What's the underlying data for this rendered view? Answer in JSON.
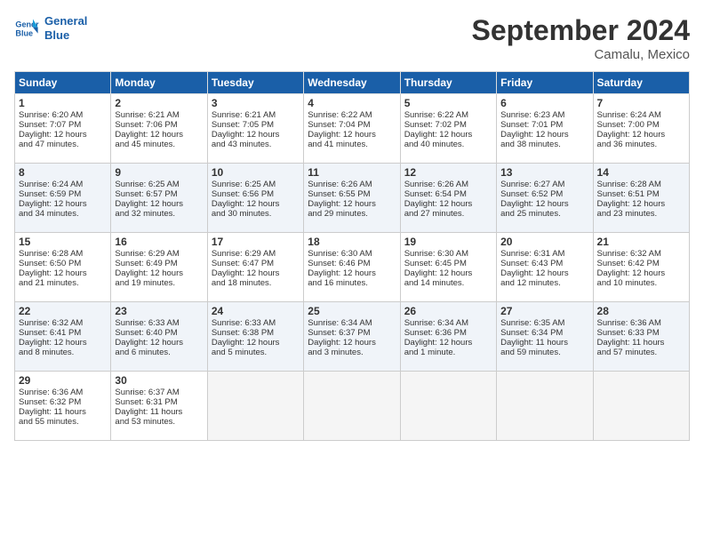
{
  "header": {
    "logo_line1": "General",
    "logo_line2": "Blue",
    "month": "September 2024",
    "location": "Camalu, Mexico"
  },
  "days_of_week": [
    "Sunday",
    "Monday",
    "Tuesday",
    "Wednesday",
    "Thursday",
    "Friday",
    "Saturday"
  ],
  "weeks": [
    [
      {
        "day": "1",
        "lines": [
          "Sunrise: 6:20 AM",
          "Sunset: 7:07 PM",
          "Daylight: 12 hours",
          "and 47 minutes."
        ]
      },
      {
        "day": "2",
        "lines": [
          "Sunrise: 6:21 AM",
          "Sunset: 7:06 PM",
          "Daylight: 12 hours",
          "and 45 minutes."
        ]
      },
      {
        "day": "3",
        "lines": [
          "Sunrise: 6:21 AM",
          "Sunset: 7:05 PM",
          "Daylight: 12 hours",
          "and 43 minutes."
        ]
      },
      {
        "day": "4",
        "lines": [
          "Sunrise: 6:22 AM",
          "Sunset: 7:04 PM",
          "Daylight: 12 hours",
          "and 41 minutes."
        ]
      },
      {
        "day": "5",
        "lines": [
          "Sunrise: 6:22 AM",
          "Sunset: 7:02 PM",
          "Daylight: 12 hours",
          "and 40 minutes."
        ]
      },
      {
        "day": "6",
        "lines": [
          "Sunrise: 6:23 AM",
          "Sunset: 7:01 PM",
          "Daylight: 12 hours",
          "and 38 minutes."
        ]
      },
      {
        "day": "7",
        "lines": [
          "Sunrise: 6:24 AM",
          "Sunset: 7:00 PM",
          "Daylight: 12 hours",
          "and 36 minutes."
        ]
      }
    ],
    [
      {
        "day": "8",
        "lines": [
          "Sunrise: 6:24 AM",
          "Sunset: 6:59 PM",
          "Daylight: 12 hours",
          "and 34 minutes."
        ]
      },
      {
        "day": "9",
        "lines": [
          "Sunrise: 6:25 AM",
          "Sunset: 6:57 PM",
          "Daylight: 12 hours",
          "and 32 minutes."
        ]
      },
      {
        "day": "10",
        "lines": [
          "Sunrise: 6:25 AM",
          "Sunset: 6:56 PM",
          "Daylight: 12 hours",
          "and 30 minutes."
        ]
      },
      {
        "day": "11",
        "lines": [
          "Sunrise: 6:26 AM",
          "Sunset: 6:55 PM",
          "Daylight: 12 hours",
          "and 29 minutes."
        ]
      },
      {
        "day": "12",
        "lines": [
          "Sunrise: 6:26 AM",
          "Sunset: 6:54 PM",
          "Daylight: 12 hours",
          "and 27 minutes."
        ]
      },
      {
        "day": "13",
        "lines": [
          "Sunrise: 6:27 AM",
          "Sunset: 6:52 PM",
          "Daylight: 12 hours",
          "and 25 minutes."
        ]
      },
      {
        "day": "14",
        "lines": [
          "Sunrise: 6:28 AM",
          "Sunset: 6:51 PM",
          "Daylight: 12 hours",
          "and 23 minutes."
        ]
      }
    ],
    [
      {
        "day": "15",
        "lines": [
          "Sunrise: 6:28 AM",
          "Sunset: 6:50 PM",
          "Daylight: 12 hours",
          "and 21 minutes."
        ]
      },
      {
        "day": "16",
        "lines": [
          "Sunrise: 6:29 AM",
          "Sunset: 6:49 PM",
          "Daylight: 12 hours",
          "and 19 minutes."
        ]
      },
      {
        "day": "17",
        "lines": [
          "Sunrise: 6:29 AM",
          "Sunset: 6:47 PM",
          "Daylight: 12 hours",
          "and 18 minutes."
        ]
      },
      {
        "day": "18",
        "lines": [
          "Sunrise: 6:30 AM",
          "Sunset: 6:46 PM",
          "Daylight: 12 hours",
          "and 16 minutes."
        ]
      },
      {
        "day": "19",
        "lines": [
          "Sunrise: 6:30 AM",
          "Sunset: 6:45 PM",
          "Daylight: 12 hours",
          "and 14 minutes."
        ]
      },
      {
        "day": "20",
        "lines": [
          "Sunrise: 6:31 AM",
          "Sunset: 6:43 PM",
          "Daylight: 12 hours",
          "and 12 minutes."
        ]
      },
      {
        "day": "21",
        "lines": [
          "Sunrise: 6:32 AM",
          "Sunset: 6:42 PM",
          "Daylight: 12 hours",
          "and 10 minutes."
        ]
      }
    ],
    [
      {
        "day": "22",
        "lines": [
          "Sunrise: 6:32 AM",
          "Sunset: 6:41 PM",
          "Daylight: 12 hours",
          "and 8 minutes."
        ]
      },
      {
        "day": "23",
        "lines": [
          "Sunrise: 6:33 AM",
          "Sunset: 6:40 PM",
          "Daylight: 12 hours",
          "and 6 minutes."
        ]
      },
      {
        "day": "24",
        "lines": [
          "Sunrise: 6:33 AM",
          "Sunset: 6:38 PM",
          "Daylight: 12 hours",
          "and 5 minutes."
        ]
      },
      {
        "day": "25",
        "lines": [
          "Sunrise: 6:34 AM",
          "Sunset: 6:37 PM",
          "Daylight: 12 hours",
          "and 3 minutes."
        ]
      },
      {
        "day": "26",
        "lines": [
          "Sunrise: 6:34 AM",
          "Sunset: 6:36 PM",
          "Daylight: 12 hours",
          "and 1 minute."
        ]
      },
      {
        "day": "27",
        "lines": [
          "Sunrise: 6:35 AM",
          "Sunset: 6:34 PM",
          "Daylight: 11 hours",
          "and 59 minutes."
        ]
      },
      {
        "day": "28",
        "lines": [
          "Sunrise: 6:36 AM",
          "Sunset: 6:33 PM",
          "Daylight: 11 hours",
          "and 57 minutes."
        ]
      }
    ],
    [
      {
        "day": "29",
        "lines": [
          "Sunrise: 6:36 AM",
          "Sunset: 6:32 PM",
          "Daylight: 11 hours",
          "and 55 minutes."
        ]
      },
      {
        "day": "30",
        "lines": [
          "Sunrise: 6:37 AM",
          "Sunset: 6:31 PM",
          "Daylight: 11 hours",
          "and 53 minutes."
        ]
      },
      {
        "day": "",
        "lines": []
      },
      {
        "day": "",
        "lines": []
      },
      {
        "day": "",
        "lines": []
      },
      {
        "day": "",
        "lines": []
      },
      {
        "day": "",
        "lines": []
      }
    ]
  ]
}
